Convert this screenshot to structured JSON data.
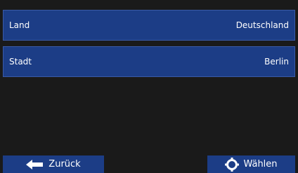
{
  "rows": [
    {
      "label": "Land",
      "value": "Deutschland"
    },
    {
      "label": "Stadt",
      "value": "Berlin"
    }
  ],
  "buttons": {
    "back": {
      "label": "Zurück",
      "icon": "arrow-left-icon"
    },
    "select": {
      "label": "Wählen",
      "icon": "crosshair-icon"
    }
  },
  "colors": {
    "background": "#1a1a1a",
    "panel": "#1c3d86",
    "text": "#ffffff"
  }
}
